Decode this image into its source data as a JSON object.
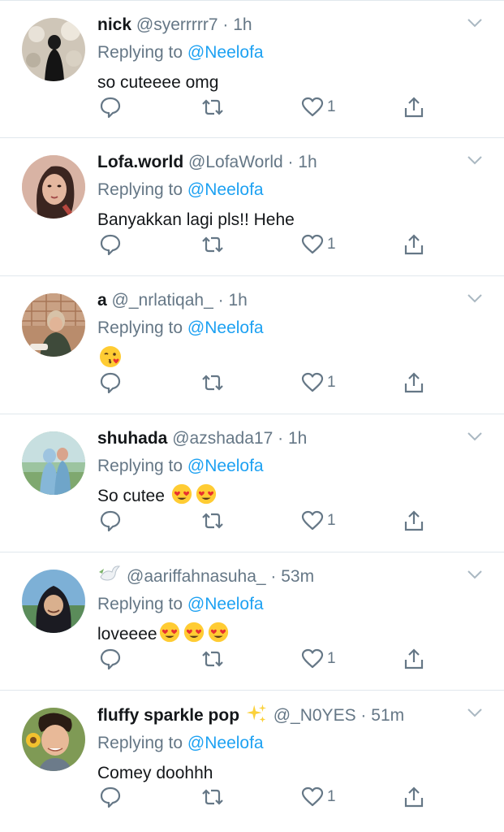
{
  "replying_label": "Replying to",
  "tweets": [
    {
      "name": "nick",
      "handle": "@syerrrrr7",
      "time": "1h",
      "mention": "@Neelofa",
      "text": "so cuteeee omg",
      "likes": "1"
    },
    {
      "name": "Lofa.world",
      "handle": "@LofaWorld",
      "time": "1h",
      "mention": "@Neelofa",
      "text": "Banyakkan lagi pls!! Hehe",
      "likes": "1"
    },
    {
      "name": "a",
      "handle": "@_nrlatiqah_",
      "time": "1h",
      "mention": "@Neelofa",
      "text": "",
      "emoji": [
        "kissing-heart"
      ],
      "likes": "1"
    },
    {
      "name": "shuhada",
      "handle": "@azshada17",
      "time": "1h",
      "mention": "@Neelofa",
      "text": "So cutee",
      "emoji": [
        "heart-eyes",
        "heart-eyes"
      ],
      "likes": "1"
    },
    {
      "name": "",
      "name_icon": "dove-icon",
      "handle": "@aariffahnasuha_",
      "time": "53m",
      "mention": "@Neelofa",
      "text": "loveeee",
      "emoji": [
        "heart-eyes",
        "heart-eyes",
        "heart-eyes"
      ],
      "likes": "1"
    },
    {
      "name": "fluffy sparkle pop",
      "name_icon": "sparkles-icon",
      "handle": "@_N0YES",
      "time": "51m",
      "mention": "@Neelofa",
      "text": "Comey doohhh",
      "likes": "1"
    }
  ],
  "colors": {
    "accent": "#1da1f2",
    "muted": "#657786",
    "text": "#14171a",
    "divider": "#e1e8ed"
  }
}
